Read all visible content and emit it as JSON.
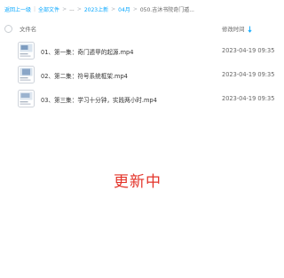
{
  "breadcrumb": {
    "back_label": "返回上一级",
    "items": [
      "全部文件",
      "...",
      "2023上新",
      "04月",
      "050.吉沐书院奇门遁..."
    ]
  },
  "table": {
    "col_name": "文件名",
    "col_mtime": "修改时间"
  },
  "files": [
    {
      "name": "01、第一集：奇门遁甲的起源.mp4",
      "mtime": "2023-04-19 09:35",
      "icon": "video-file-icon"
    },
    {
      "name": "02、第二集：符号系统框架.mp4",
      "mtime": "2023-04-19 09:35",
      "icon": "video-file-icon"
    },
    {
      "name": "03、第三集：学习十分钟，实践两小时.mp4",
      "mtime": "2023-04-19 09:35",
      "icon": "video-file-icon"
    }
  ],
  "overlay_text": "更新中",
  "colors": {
    "link": "#06a7ff",
    "overlay": "#e3342a"
  }
}
